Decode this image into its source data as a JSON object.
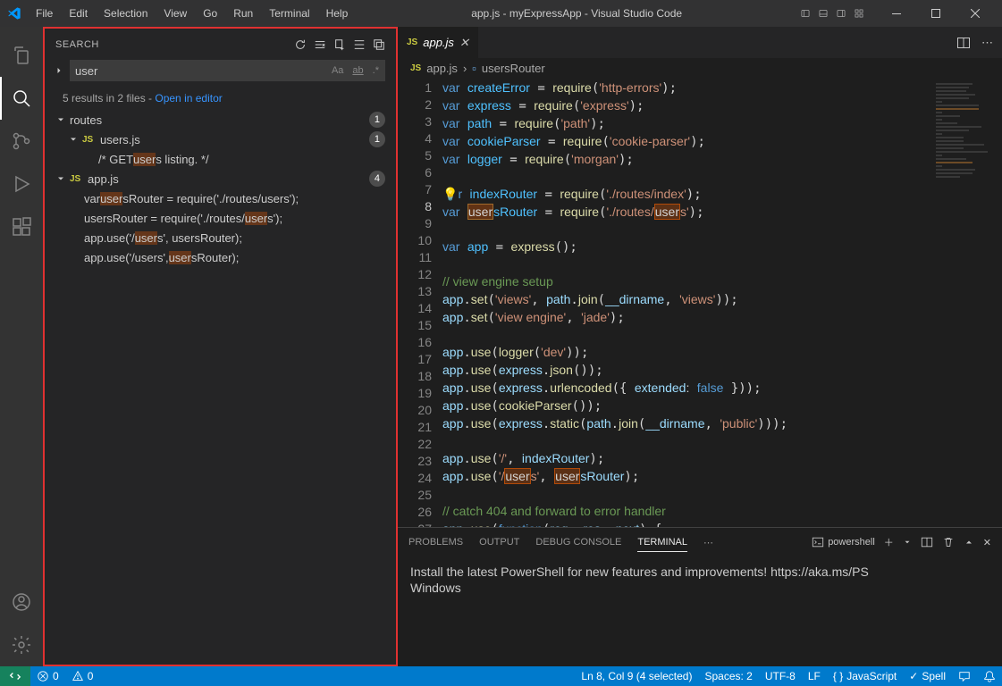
{
  "titlebar": {
    "menus": [
      "File",
      "Edit",
      "Selection",
      "View",
      "Go",
      "Run",
      "Terminal",
      "Help"
    ],
    "title": "app.js - myExpressApp - Visual Studio Code"
  },
  "search": {
    "header": "SEARCH",
    "query": "user",
    "matchCase": "Aa",
    "wholeWord": "ab",
    "regex": ".*",
    "results_text_a": "5 results in 2 files - ",
    "open_in_editor": "Open in editor",
    "tree": {
      "routes": {
        "label": "routes",
        "badge": "1"
      },
      "usersjs": {
        "label": "users.js",
        "badge": "1"
      },
      "usersjs_line": {
        "pre": "/* GET ",
        "hl": "user",
        "post": "s listing. */"
      },
      "appjs": {
        "label": "app.js",
        "badge": "4"
      },
      "m1": {
        "pre": "var ",
        "hl": "user",
        "post": "sRouter = require('./routes/users');"
      },
      "m2": {
        "pre": "usersRouter = require('./routes/",
        "hl": "user",
        "post": "s');"
      },
      "m3": {
        "pre": "app.use('/",
        "hl": "user",
        "post": "s', usersRouter);"
      },
      "m4": {
        "pre": "app.use('/users', ",
        "hl": "user",
        "post": "sRouter);"
      }
    }
  },
  "editor": {
    "tab_name": "app.js",
    "breadcrumb_file": "app.js",
    "breadcrumb_symbol": "usersRouter"
  },
  "panel": {
    "tabs": {
      "problems": "PROBLEMS",
      "output": "OUTPUT",
      "debug": "DEBUG CONSOLE",
      "terminal": "TERMINAL"
    },
    "shell": "powershell",
    "content_l1": "Install the latest PowerShell for new features and improvements! https://aka.ms/PS",
    "content_l2": "Windows"
  },
  "statusbar": {
    "errors": "0",
    "warnings": "0",
    "cursor": "Ln 8, Col 9 (4 selected)",
    "spaces": "Spaces: 2",
    "encoding": "UTF-8",
    "eol": "LF",
    "lang": "JavaScript",
    "spell": "Spell"
  }
}
